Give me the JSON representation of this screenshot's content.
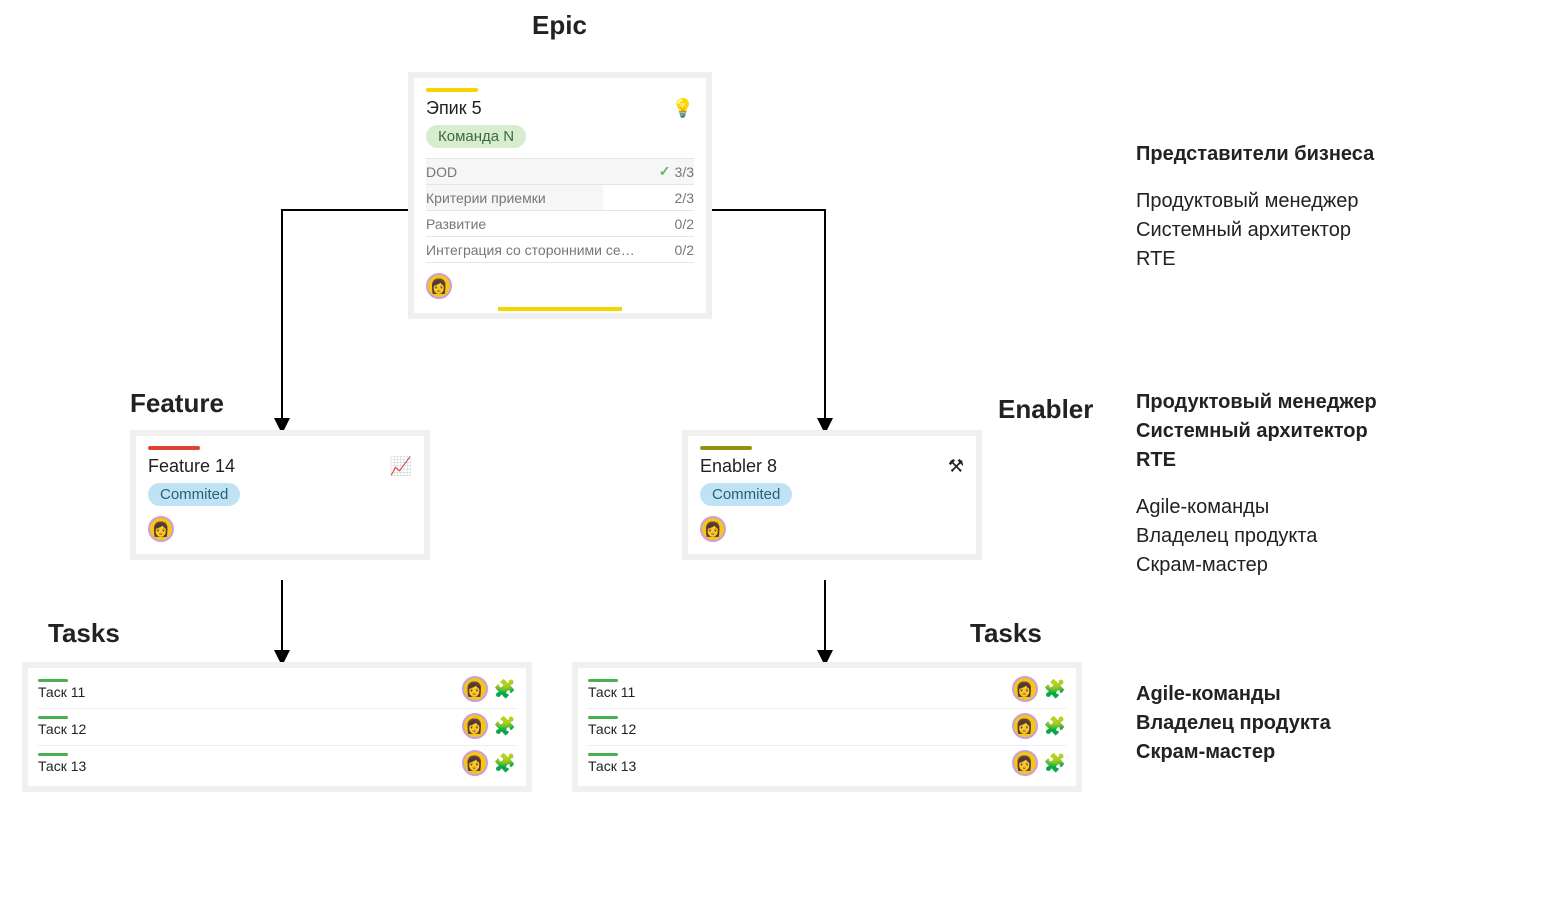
{
  "headings": {
    "epic": "Epic",
    "feature": "Feature",
    "enabler": "Enabler",
    "tasks_left": "Tasks",
    "tasks_right": "Tasks"
  },
  "epic_card": {
    "title": "Эпик 5",
    "icon_name": "lightbulb-icon",
    "team_tag": "Команда N",
    "rows": [
      {
        "label": "DOD",
        "value": "3/3",
        "pct": 100,
        "done": true
      },
      {
        "label": "Критерии приемки",
        "value": "2/3",
        "pct": 66,
        "done": false
      },
      {
        "label": "Развитие",
        "value": "0/2",
        "pct": 0,
        "done": false
      },
      {
        "label": "Интеграция со сторонними серви…",
        "value": "0/2",
        "pct": 0,
        "done": false
      }
    ]
  },
  "feature_card": {
    "title": "Feature 14",
    "icon_name": "chart-up-icon",
    "status_tag": "Commited"
  },
  "enabler_card": {
    "title": "Enabler 8",
    "icon_name": "tools-icon",
    "status_tag": "Commited"
  },
  "tasks_left": [
    {
      "title": "Таск 11"
    },
    {
      "title": "Таск 12"
    },
    {
      "title": "Таск 13"
    }
  ],
  "tasks_right": [
    {
      "title": "Таск 11"
    },
    {
      "title": "Таск 12"
    },
    {
      "title": "Таск 13"
    }
  ],
  "right_col": {
    "row1_bold": [
      "Представители бизнеса"
    ],
    "row1_plain": [
      "Продуктовый менеджер",
      "Системный архитектор",
      "RTE"
    ],
    "row2_bold": [
      "Продуктовый менеджер",
      "Системный архитектор",
      "RTE"
    ],
    "row2_plain": [
      "Agile-команды",
      "Владелец продукта",
      "Скрам-мастер"
    ],
    "row3_bold": [
      "Agile-команды",
      "Владелец продукта",
      "Скрам-мастер"
    ]
  }
}
